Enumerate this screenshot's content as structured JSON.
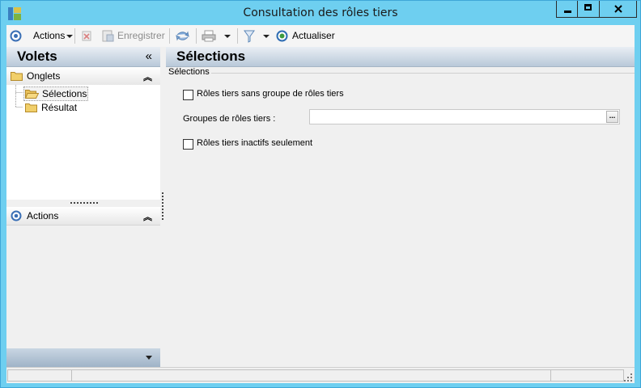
{
  "window": {
    "title": "Consultation des rôles tiers",
    "accent_color": "#6ecff0"
  },
  "toolbar": {
    "actions_label": "Actions",
    "save_label": "Enregistrer",
    "refresh_label": "Actualiser"
  },
  "left_panel": {
    "title": "Volets",
    "collapse_glyph": "«",
    "tabs_section": {
      "label": "Onglets",
      "items": [
        {
          "label": "Sélections"
        },
        {
          "label": "Résultat"
        }
      ]
    },
    "actions_section": {
      "label": "Actions"
    }
  },
  "right_panel": {
    "title": "Sélections",
    "group_label": "Sélections",
    "checkbox_no_group": {
      "label": "Rôles tiers sans groupe de rôles tiers",
      "checked": false
    },
    "groups_field": {
      "label": "Groupes de rôles tiers :",
      "value": "",
      "button_label": "..."
    },
    "checkbox_inactive": {
      "label": "Rôles tiers inactifs seulement",
      "checked": false
    }
  }
}
